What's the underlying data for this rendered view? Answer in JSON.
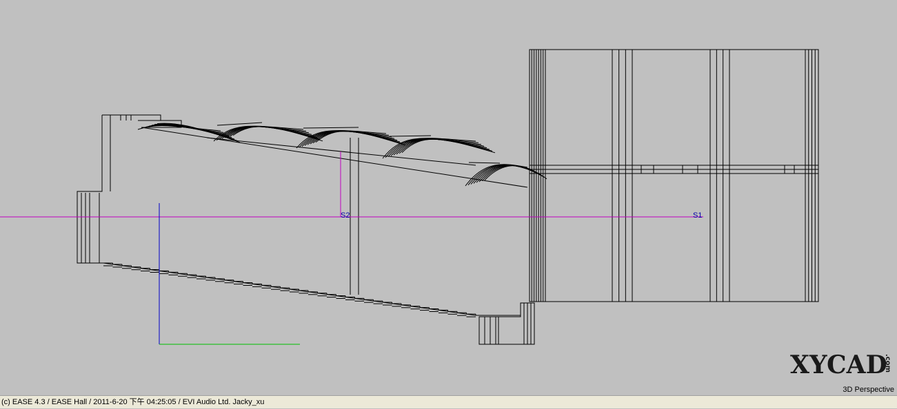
{
  "status_bar": {
    "text": "(c) EASE 4.3  / EASE Hall  / 2011-6-20 下午 04:25:05 / EVI Audio Ltd. Jacky_xu"
  },
  "viewport": {
    "view_mode": "3D Perspective",
    "sources": [
      {
        "label": "S2"
      },
      {
        "label": "S1"
      }
    ]
  },
  "logo": {
    "text": "XYCAD",
    "suffix": ".com"
  },
  "colors": {
    "background": "#c0c0c0",
    "wireframe": "#000000",
    "axis_x": "#00c000",
    "axis_z": "#0000c8",
    "source_line": "#c000c0",
    "status_bar": "#ece9d8"
  }
}
